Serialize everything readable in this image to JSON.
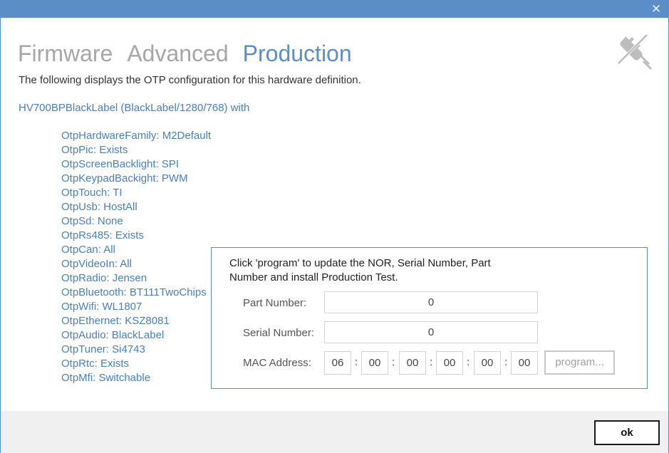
{
  "window": {
    "close_symbol": "✕"
  },
  "tabs": [
    {
      "label": "Firmware",
      "active": false
    },
    {
      "label": "Advanced",
      "active": false
    },
    {
      "label": "Production",
      "active": true
    }
  ],
  "header_icon": "plug-disconnected-icon",
  "description": "The following displays the OTP configuration for this hardware definition.",
  "hardware_definition": "HV700BPBlackLabel (BlackLabel/1280/768) with",
  "otp_entries": [
    "OtpHardwareFamily: M2Default",
    "OtpPic: Exists",
    "OtpScreenBacklight: SPI",
    "OtpKeypadBackight: PWM",
    "OtpTouch: TI",
    "OtpUsb: HostAll",
    "OtpSd: None",
    "OtpRs485: Exists",
    "OtpCan: All",
    "OtpVideoIn: All",
    "OtpRadio: Jensen",
    "OtpBluetooth: BT111TwoChips",
    "OtpWifi: WL1807",
    "OtpEthernet: KSZ8081",
    "OtpAudio: BlackLabel",
    "OtpTuner: Si4743",
    "OtpRtc: Exists",
    "OtpMfi: Switchable"
  ],
  "production": {
    "instructions": "Click 'program' to update the NOR, Serial Number, Part Number and install Production Test.",
    "part_number_label": "Part Number:",
    "part_number_value": "0",
    "serial_number_label": "Serial Number:",
    "serial_number_value": "0",
    "mac_label": "MAC Address:",
    "mac_octets": [
      "06",
      "00",
      "00",
      "00",
      "00",
      "00"
    ],
    "mac_separator": ":",
    "program_label": "program..."
  },
  "footer": {
    "ok_label": "ok"
  },
  "colors": {
    "accent": "#5b8ec7",
    "link_text": "#4a7fb8",
    "inactive_tab": "#a6a6a6",
    "footer_bg": "#f0f0f0"
  }
}
